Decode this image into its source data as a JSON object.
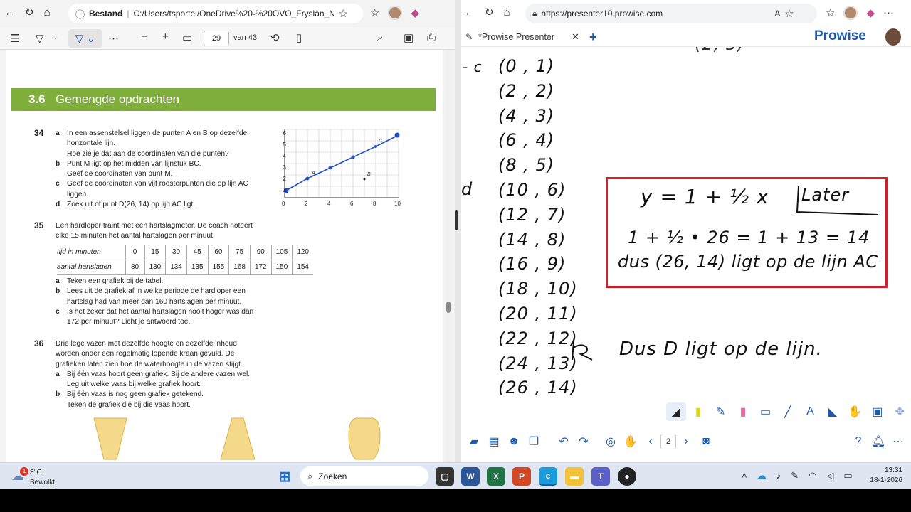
{
  "left_browser": {
    "address_label": "Bestand",
    "address_url": "C:/Users/tsportel/OneDrive%20-%20OVO_Fryslân_No...",
    "page_number": "29",
    "page_total": "van 43",
    "zoom_minus": "−",
    "zoom_plus": "+"
  },
  "doc": {
    "section_number": "3.6",
    "section_title": "Gemengde opdrachten",
    "q34": {
      "num": "34",
      "a_letter": "a",
      "a_text": "In een assenstelsel liggen de punten A en B op dezelfde horizontale lijn.",
      "a_text2": "Hoe zie je dat aan de coördinaten van die punten?",
      "b_letter": "b",
      "b_text": "Punt M ligt op het midden van lijnstuk BC.",
      "b_text2": "Geef de coördinaten van punt M.",
      "c_letter": "c",
      "c_text": "Geef de coördinaten van vijf roosterpunten die op lijn AC liggen.",
      "d_letter": "d",
      "d_text": "Zoek uit of punt D(26, 14) op lijn AC ligt."
    },
    "q35": {
      "num": "35",
      "intro": "Een hardloper traint met een hartslagmeter. De coach noteert elke 15 minuten het aantal hartslagen per minuut.",
      "row1_label": "tijd in minuten",
      "row1": [
        "0",
        "15",
        "30",
        "45",
        "60",
        "75",
        "90",
        "105",
        "120"
      ],
      "row2_label": "aantal hartslagen",
      "row2": [
        "80",
        "130",
        "134",
        "135",
        "155",
        "168",
        "172",
        "150",
        "154"
      ],
      "a_letter": "a",
      "a_text": "Teken een grafiek bij de tabel.",
      "b_letter": "b",
      "b_text": "Lees uit de grafiek af in welke periode de hardloper een hartslag had van meer dan 160 hartslagen per minuut.",
      "c_letter": "c",
      "c_text": "Is het zeker dat het aantal hartslagen nooit hoger was dan 172 per minuut? Licht je antwoord toe."
    },
    "q36": {
      "num": "36",
      "intro": "Drie lege vazen met dezelfde hoogte en dezelfde inhoud worden onder een regelmatig lopende kraan gevuld. De grafieken laten zien hoe de waterhoogte in de vazen stijgt.",
      "a_letter": "a",
      "a_text": "Bij één vaas hoort geen grafiek. Bij de andere vazen wel.",
      "a_text2": "Leg uit welke vaas bij welke grafiek hoort.",
      "b_letter": "b",
      "b_text": "Bij één vaas is nog geen grafiek getekend.",
      "b_text2": "Teken de grafiek die bij die vaas hoort."
    },
    "graph": {
      "x_ticks": [
        "0",
        "2",
        "4",
        "6",
        "8",
        "10"
      ],
      "y_ticks": [
        "1",
        "2",
        "3",
        "4",
        "5",
        "6"
      ],
      "label_A": "A",
      "label_B": "B",
      "label_C": "C"
    }
  },
  "right_browser": {
    "address_url": "https://presenter10.prowise.com",
    "tab_title": "*Prowise Presenter",
    "brand": "Prowise",
    "page_number": "2"
  },
  "whiteboard": {
    "top_partial": "(2, 3)",
    "left_c": "- c",
    "left_d": "d",
    "points": [
      "(0 , 1)",
      "(2 , 2)",
      "(4 , 3)",
      "(6 , 4)",
      "(8 , 5)",
      "(10 , 6)",
      "(12 , 7)",
      "(14 , 8)",
      "(16 , 9)",
      "(18 , 10)",
      "(20 , 11)",
      "(22 , 12)",
      "(24 , 13)",
      "(26 , 14)"
    ],
    "conclusion": "Dus D ligt op de lijn.",
    "box_formula": "y = 1 + ½ x",
    "box_later": "Later",
    "box_calc": "1 + ½ • 26 = 1 + 13 = 14",
    "box_conclusion": "dus (26, 14) ligt op de lijn AC"
  },
  "taskbar": {
    "weather_temp": "3°C",
    "weather_desc": "Bewolkt",
    "weather_badge": "1",
    "search_placeholder": "Zoeken",
    "time": "13:31",
    "date": "18-1-2026"
  },
  "colors": {
    "banner_green": "#7faf3a",
    "box_red": "#d81e2a",
    "prowise_blue": "#1f5aa8",
    "graph_blue": "#1f4fc0"
  }
}
